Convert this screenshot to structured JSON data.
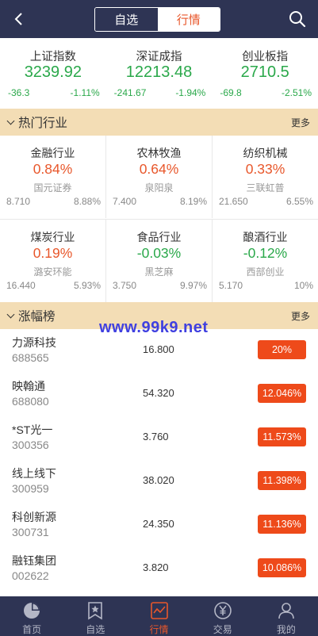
{
  "header": {
    "tabs": [
      {
        "label": "自选",
        "active": false
      },
      {
        "label": "行情",
        "active": true
      }
    ],
    "back_icon": "chevron-left-icon",
    "search_icon": "search-icon"
  },
  "indices": [
    {
      "name": "上证指数",
      "value": "3239.92",
      "change": "-36.3",
      "percent": "-1.11%"
    },
    {
      "name": "深证成指",
      "value": "12213.48",
      "change": "-241.67",
      "percent": "-1.94%"
    },
    {
      "name": "创业板指",
      "value": "2710.5",
      "change": "-69.8",
      "percent": "-2.51%"
    }
  ],
  "hot_industries": {
    "title": "热门行业",
    "more": "更多",
    "items": [
      {
        "name": "金融行业",
        "percent": "0.84%",
        "stock": "国元证券",
        "price": "8.710",
        "rate": "8.88%",
        "dir": "up"
      },
      {
        "name": "农林牧渔",
        "percent": "0.64%",
        "stock": "泉阳泉",
        "price": "7.400",
        "rate": "8.19%",
        "dir": "up"
      },
      {
        "name": "纺织机械",
        "percent": "0.33%",
        "stock": "三联虹普",
        "price": "21.650",
        "rate": "6.55%",
        "dir": "up"
      },
      {
        "name": "煤炭行业",
        "percent": "0.19%",
        "stock": "潞安环能",
        "price": "16.440",
        "rate": "5.93%",
        "dir": "up"
      },
      {
        "name": "食品行业",
        "percent": "-0.03%",
        "stock": "黑芝麻",
        "price": "3.750",
        "rate": "9.97%",
        "dir": "down"
      },
      {
        "name": "酿酒行业",
        "percent": "-0.12%",
        "stock": "西部创业",
        "price": "5.170",
        "rate": "10%",
        "dir": "down"
      }
    ]
  },
  "gainers": {
    "title": "涨幅榜",
    "more": "更多",
    "rows": [
      {
        "name": "力源科技",
        "code": "688565",
        "price": "16.800",
        "percent": "20%"
      },
      {
        "name": "映翰通",
        "code": "688080",
        "price": "54.320",
        "percent": "12.046%"
      },
      {
        "name": "*ST光一",
        "code": "300356",
        "price": "3.760",
        "percent": "11.573%"
      },
      {
        "name": "线上线下",
        "code": "300959",
        "price": "38.020",
        "percent": "11.398%"
      },
      {
        "name": "科创新源",
        "code": "300731",
        "price": "24.350",
        "percent": "11.136%"
      },
      {
        "name": "融钰集团",
        "code": "002622",
        "price": "3.820",
        "percent": "10.086%"
      }
    ]
  },
  "watermark": "www.99k9.net",
  "nav": [
    {
      "label": "首页",
      "icon": "pie-chart-icon",
      "active": false
    },
    {
      "label": "自选",
      "icon": "bookmark-star-icon",
      "active": false
    },
    {
      "label": "行情",
      "icon": "trend-chart-icon",
      "active": true
    },
    {
      "label": "交易",
      "icon": "yen-circle-icon",
      "active": false
    },
    {
      "label": "我的",
      "icon": "user-icon",
      "active": false
    }
  ],
  "colors": {
    "header_bg": "#2e3454",
    "section_bg": "#f3ddb5",
    "up": "#e8572b",
    "down": "#2aa84a",
    "badge": "#ee4a1a"
  }
}
